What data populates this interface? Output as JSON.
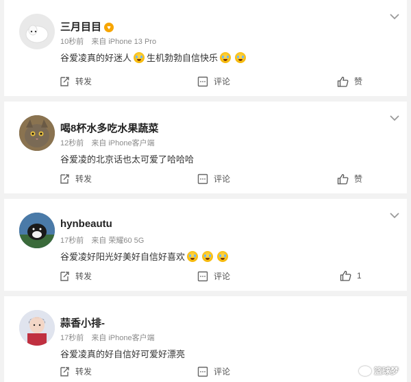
{
  "comments": [
    {
      "name": "三月目目",
      "time": "10秒前",
      "source": "来自 iPhone 13 Pro",
      "text_parts": [
        "谷爱凌真的好迷人",
        "生机勃勃自信快乐"
      ],
      "likes": "赞",
      "avatar_desc": "white-puppy"
    },
    {
      "name": "喝8杯水多吃水果蔬菜",
      "time": "12秒前",
      "source": "来自 iPhone客户端",
      "text": "谷爱凌的北京话也太可爱了哈哈哈",
      "likes": "赞",
      "avatar_desc": "cat"
    },
    {
      "name": "hynbeautu",
      "time": "17秒前",
      "source": "来自 荣耀60 5G",
      "text": "谷爱凌好阳光好美好自信好喜欢",
      "likes": "1",
      "avatar_desc": "animal"
    },
    {
      "name": "蒜香小排-",
      "time": "17秒前",
      "source": "来自 iPhone客户端",
      "text": "谷爱凌真的好自信好可爱好漂亮",
      "likes": "",
      "avatar_desc": "person"
    }
  ],
  "actions": {
    "repost": "转发",
    "comment": "评论"
  },
  "watermark": "篮球梦",
  "colors": {
    "background": "#f2f2f2",
    "card": "#ffffff",
    "meta": "#8a8a8a",
    "vip_badge": "#f7a500"
  }
}
